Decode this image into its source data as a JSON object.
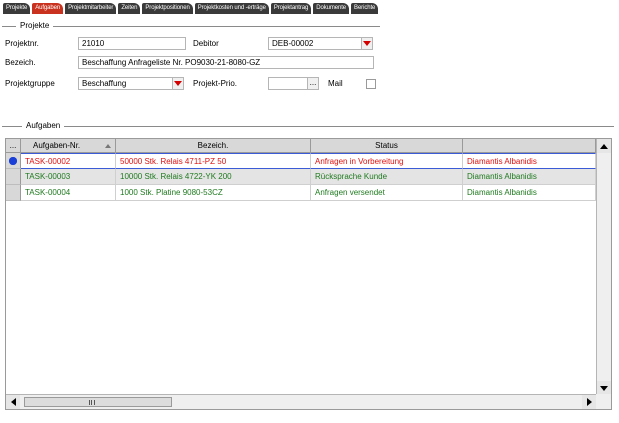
{
  "tabs": [
    {
      "label": "Projekte",
      "active": false
    },
    {
      "label": "Aufgaben",
      "active": true
    },
    {
      "label": "Projektmitarbeiter",
      "active": false
    },
    {
      "label": "Zeiten",
      "active": false
    },
    {
      "label": "Projektpositionen",
      "active": false
    },
    {
      "label": "Projektkosten und -erträge",
      "active": false
    },
    {
      "label": "Projektantrag",
      "active": false
    },
    {
      "label": "Dokumente",
      "active": false
    },
    {
      "label": "Berichte",
      "active": false
    }
  ],
  "projekte": {
    "legend": "Projekte",
    "projektnr_label": "Projektnr.",
    "projektnr_value": "21010",
    "debitor_label": "Debitor",
    "debitor_value": "DEB-00002",
    "bezeich_label": "Bezeich.",
    "bezeich_value": "Beschaffung Anfrageliste Nr. PO9030-21-8080-GZ",
    "projektgruppe_label": "Projektgruppe",
    "projektgruppe_value": "Beschaffung",
    "prio_label": "Projekt-Prio.",
    "prio_value": "",
    "dots": "...",
    "mail_label": "Mail"
  },
  "aufgaben": {
    "legend": "Aufgaben",
    "rowhead_dots": "...",
    "columns": [
      "Aufgaben-Nr.",
      "Bezeich.",
      "Status",
      ""
    ],
    "rows": [
      {
        "nr": "TASK-00002",
        "bezeich": "50000 Stk. Relais 4711-PZ 50",
        "status": "Anfragen in Vorbereitung",
        "person": "Diamantis Albanidis",
        "color": "#e01010"
      },
      {
        "nr": "TASK-00003",
        "bezeich": "10000 Stk. Relais 4722-YK 200",
        "status": "Rücksprache Kunde",
        "person": "Diamantis Albanidis",
        "color": "#1f7a1f"
      },
      {
        "nr": "TASK-00004",
        "bezeich": "1000 Stk. Platine 9080-53CZ",
        "status": "Anfragen versendet",
        "person": "Diamantis Albanidis",
        "color": "#1f7a1f"
      }
    ]
  },
  "colors": {
    "active_tab": "#c8321e",
    "tab": "#3a3a3a",
    "selection": "#3b5bd6"
  }
}
